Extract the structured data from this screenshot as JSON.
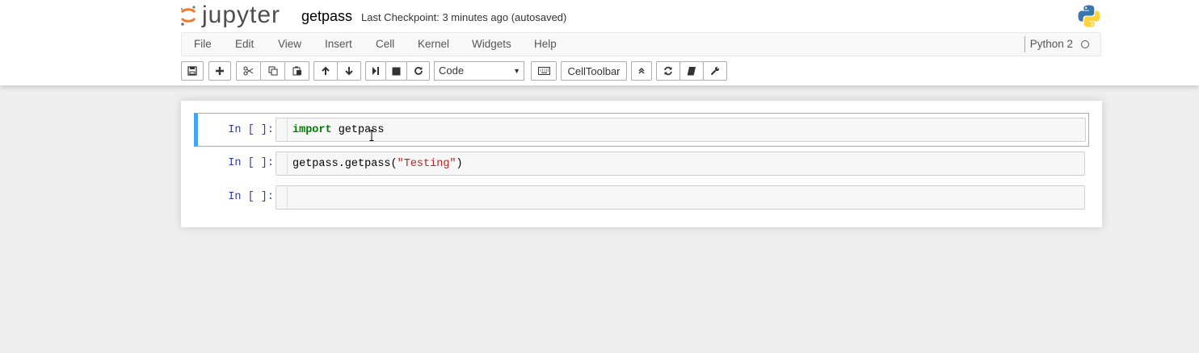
{
  "app": {
    "logo_text": "jupyter",
    "notebook_name": "getpass",
    "checkpoint": "Last Checkpoint: 3 minutes ago (autosaved)"
  },
  "menu": {
    "items": [
      "File",
      "Edit",
      "View",
      "Insert",
      "Cell",
      "Kernel",
      "Widgets",
      "Help"
    ],
    "kernel_name": "Python 2"
  },
  "toolbar": {
    "buttons": [
      "save-icon",
      "plus-icon",
      "cut-icon",
      "copy-icon",
      "paste-icon",
      "arrow-up-icon",
      "arrow-down-icon",
      "step-forward-icon",
      "stop-icon",
      "refresh-icon"
    ],
    "cell_type": "Code",
    "keyboard_icon": "keyboard-icon",
    "celltoolbar_label": "CellToolbar",
    "extra_buttons": [
      "collapse-up-icon",
      "reload-icon",
      "book-icon",
      "wrench-icon"
    ]
  },
  "cells": [
    {
      "prompt": "In [ ]:",
      "code_keyword": "import",
      "code_rest": " getpass",
      "selected": true
    },
    {
      "prompt": "In [ ]:",
      "code_plain": "getpass.getpass(",
      "code_string": "\"Testing\"",
      "code_close": ")",
      "selected": false
    },
    {
      "prompt": "In [ ]:",
      "code_plain": "",
      "selected": false
    }
  ],
  "colors": {
    "selected_bar": "#42a5f5",
    "prompt_color": "#303f9f",
    "keyword": "#008000",
    "string": "#ba2121",
    "jupyter_orange": "#f37726"
  }
}
